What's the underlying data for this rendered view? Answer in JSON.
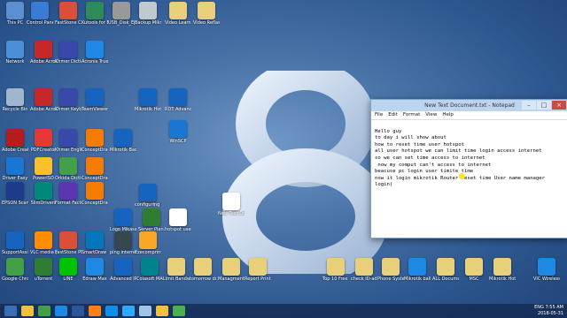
{
  "desktop": {
    "icons": [
      {
        "label": "This PC",
        "color": "#5b8fd0"
      },
      {
        "label": "Control Panel",
        "color": "#3a7bd5"
      },
      {
        "label": "FastStone Capture",
        "color": "#d94f3a"
      },
      {
        "label": "Kutools for Excel",
        "color": "#2e8b57"
      },
      {
        "label": "USB_Disk_Eje",
        "color": "#999999"
      },
      {
        "label": "Backup Mikrotik",
        "color": "#c0c8d0"
      },
      {
        "label": "Video Learning Other Skill",
        "color": "#e8d07a"
      },
      {
        "label": "Video Reflash Service OMS",
        "color": "#e8d07a"
      },
      {
        "label": "Network",
        "color": "#4a90d9"
      },
      {
        "label": "Adobe Acrobat DC",
        "color": "#c62828"
      },
      {
        "label": "Khmer Dictionary",
        "color": "#3949ab"
      },
      {
        "label": "Acronis True Image",
        "color": "#1e88e5"
      },
      {
        "label": "Recycle Bin",
        "color": "#9fb6cc"
      },
      {
        "label": "Adobe Acrobat",
        "color": "#c62828"
      },
      {
        "label": "Khmer Keyboard",
        "color": "#3949ab"
      },
      {
        "label": "TeamViewer Remote",
        "color": "#1565c0"
      },
      {
        "label": "Adobe Creative",
        "color": "#b71c1c"
      },
      {
        "label": "PDFCreator",
        "color": "#e53935"
      },
      {
        "label": "Khmer English",
        "color": "#3949ab"
      },
      {
        "label": "ConceptDraw Office",
        "color": "#f57c00"
      },
      {
        "label": "Driver Easy",
        "color": "#1976d2"
      },
      {
        "label": "PowerISO",
        "color": "#fbc02d"
      },
      {
        "label": "Orkida Dictionary",
        "color": "#43a047"
      },
      {
        "label": "ConceptDraw Office PRO",
        "color": "#f57c00"
      },
      {
        "label": "EPSON Scan",
        "color": "#1e3a8a"
      },
      {
        "label": "SlimDrivers",
        "color": "#00897b"
      },
      {
        "label": "Format Factory",
        "color": "#5e35b1"
      },
      {
        "label": "ConceptDraw Office MIN",
        "color": "#f57c00"
      },
      {
        "label": "SupportAssist",
        "color": "#1565c0"
      },
      {
        "label": "VLC media player",
        "color": "#ff8f00"
      },
      {
        "label": "FastStone Photo Resizer",
        "color": "#d94f3a"
      },
      {
        "label": "SmartDraw 2012",
        "color": "#0277bd"
      },
      {
        "label": "Google Chrome",
        "color": "#43a047"
      },
      {
        "label": "uTorrent",
        "color": "#2e7d32"
      },
      {
        "label": "LINE",
        "color": "#00c300"
      },
      {
        "label": "Edraw Max",
        "color": "#1e88e5"
      },
      {
        "label": "Advanced IP Scanner",
        "color": "#1565c0"
      },
      {
        "label": "Colasoft MAC Scanner",
        "color": "#00838f"
      },
      {
        "label": "Limit Bandwidth",
        "color": "#e8d07a"
      },
      {
        "label": "tomorrow download",
        "color": "#e8d07a"
      },
      {
        "label": "Managment Switch TP",
        "color": "#e8d07a"
      },
      {
        "label": "Report Printer",
        "color": "#e8d07a"
      },
      {
        "label": "Top 10 Free Downloads",
        "color": "#e8d07a"
      },
      {
        "label": "check ID-adm 02020 BH",
        "color": "#e8d07a"
      },
      {
        "label": "Phone System NL",
        "color": "#e8d07a"
      },
      {
        "label": "Mikrotik ball mikrotik",
        "color": "#1e88e5"
      },
      {
        "label": "ALL Document",
        "color": "#e8d07a"
      },
      {
        "label": "MSC",
        "color": "#e8d07a"
      },
      {
        "label": "Mikrotik Hotspot",
        "color": "#e8d07a"
      },
      {
        "label": "VIC WirelessR",
        "color": "#1e88e5"
      },
      {
        "label": "New Text Document",
        "color": "#ffffff"
      },
      {
        "label": "hotspot user reset count",
        "color": "#ffffff"
      },
      {
        "label": "Server Plan.xlsx",
        "color": "#2e7d32"
      },
      {
        "label": "Logo Mikasa",
        "color": "#1565c0"
      },
      {
        "label": "ping internet.bat",
        "color": "#37474f"
      },
      {
        "label": "Ezecomprint",
        "color": "#f9a825"
      },
      {
        "label": "RDT Advance Request.docx",
        "color": "#1565c0"
      },
      {
        "label": "Mikrotik Hotspot Quick",
        "color": "#1565c0"
      },
      {
        "label": "WinSCP",
        "color": "#1976d2"
      },
      {
        "label": "configuring a NTP server",
        "color": "#1565c0"
      },
      {
        "label": "Mikrotik Backup",
        "color": "#1565c0"
      }
    ]
  },
  "notepad": {
    "title": "New Text Document.txt - Notepad",
    "menu": [
      "File",
      "Edit",
      "Format",
      "View",
      "Help"
    ],
    "lines": [
      "Hello guy",
      "to day i will show about",
      "how to reset time user hotspot",
      "all user hotspot we can limit time login access internet",
      "so we can set time access to internet",
      " now my comput can't access to internet",
      "beacuse pc login user timite time",
      "now it login mikrotik Router reset time User name manager",
      "login|"
    ]
  },
  "taskbar": {
    "items": [
      {
        "name": "start",
        "color": "#3b6fb5"
      },
      {
        "name": "explorer",
        "color": "#f0c040"
      },
      {
        "name": "chrome",
        "color": "#43a047"
      },
      {
        "name": "media",
        "color": "#1e88e5"
      },
      {
        "name": "word",
        "color": "#2b579a"
      },
      {
        "name": "illustrator",
        "color": "#ff7f18"
      },
      {
        "name": "teamviewer",
        "color": "#0e8ee9"
      },
      {
        "name": "photoshop",
        "color": "#31a8ff"
      },
      {
        "name": "notepad",
        "color": "#9fc4e8"
      },
      {
        "name": "explorer2",
        "color": "#f0c040"
      },
      {
        "name": "camtasia",
        "color": "#4caf50"
      }
    ],
    "clock_time": "7:55 AM",
    "clock_date": "2018-05-31",
    "lang": "ENG"
  }
}
